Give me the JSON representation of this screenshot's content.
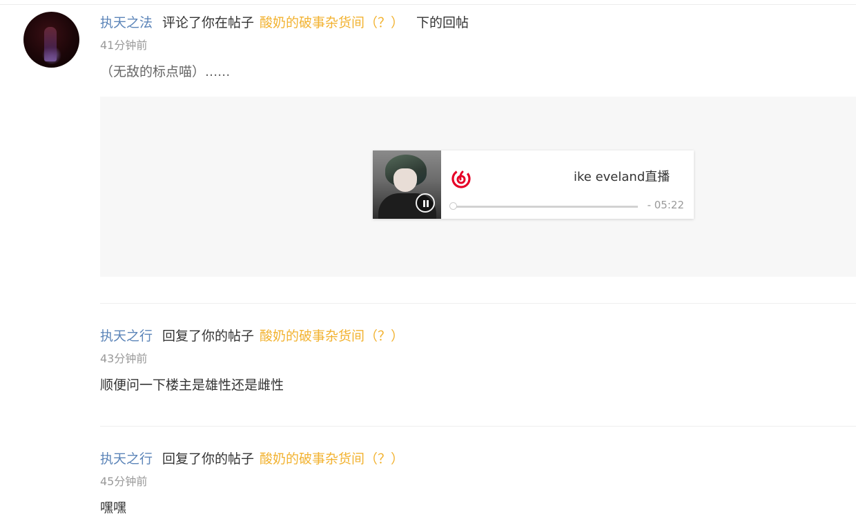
{
  "notifications": [
    {
      "user": "执天之法",
      "action": "评论了你在帖子",
      "post": "酸奶的破事杂货间（？）",
      "suffix": "下的回帖",
      "time": "41分钟前",
      "content": "（无敌的标点喵）......",
      "media": {
        "title": "ike eveland直播",
        "duration": "- 05:22",
        "progress": 0
      }
    },
    {
      "user": "执天之行",
      "action": "回复了你的帖子",
      "post": "酸奶的破事杂货间（？）",
      "time": "43分钟前",
      "content": "顺便问一下楼主是雄性还是雌性"
    },
    {
      "user": "执天之行",
      "action": "回复了你的帖子",
      "post": "酸奶的破事杂货间（？）",
      "time": "45分钟前",
      "content": "嘿嘿"
    }
  ],
  "colors": {
    "username": "#5b84b8",
    "post_link": "#f2b230",
    "muted": "#999999",
    "netease_red": "#e60026"
  }
}
